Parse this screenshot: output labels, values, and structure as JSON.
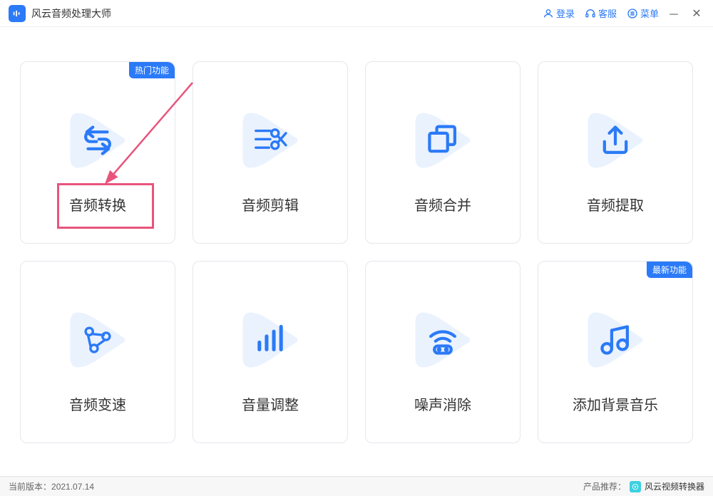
{
  "app": {
    "title": "风云音频处理大师"
  },
  "titlebar": {
    "login": "登录",
    "support": "客服",
    "menu": "菜单"
  },
  "badges": {
    "hot": "热门功能",
    "new": "最新功能"
  },
  "cards": [
    {
      "label": "音频转换"
    },
    {
      "label": "音频剪辑"
    },
    {
      "label": "音频合并"
    },
    {
      "label": "音频提取"
    },
    {
      "label": "音频变速"
    },
    {
      "label": "音量调整"
    },
    {
      "label": "噪声消除"
    },
    {
      "label": "添加背景音乐"
    }
  ],
  "footer": {
    "version_label": "当前版本：",
    "version": "2021.07.14",
    "recommend_label": "产品推荐：",
    "recommend_product": "风云视频转换器"
  },
  "annotation": {
    "highlight_target": "音频转换"
  }
}
